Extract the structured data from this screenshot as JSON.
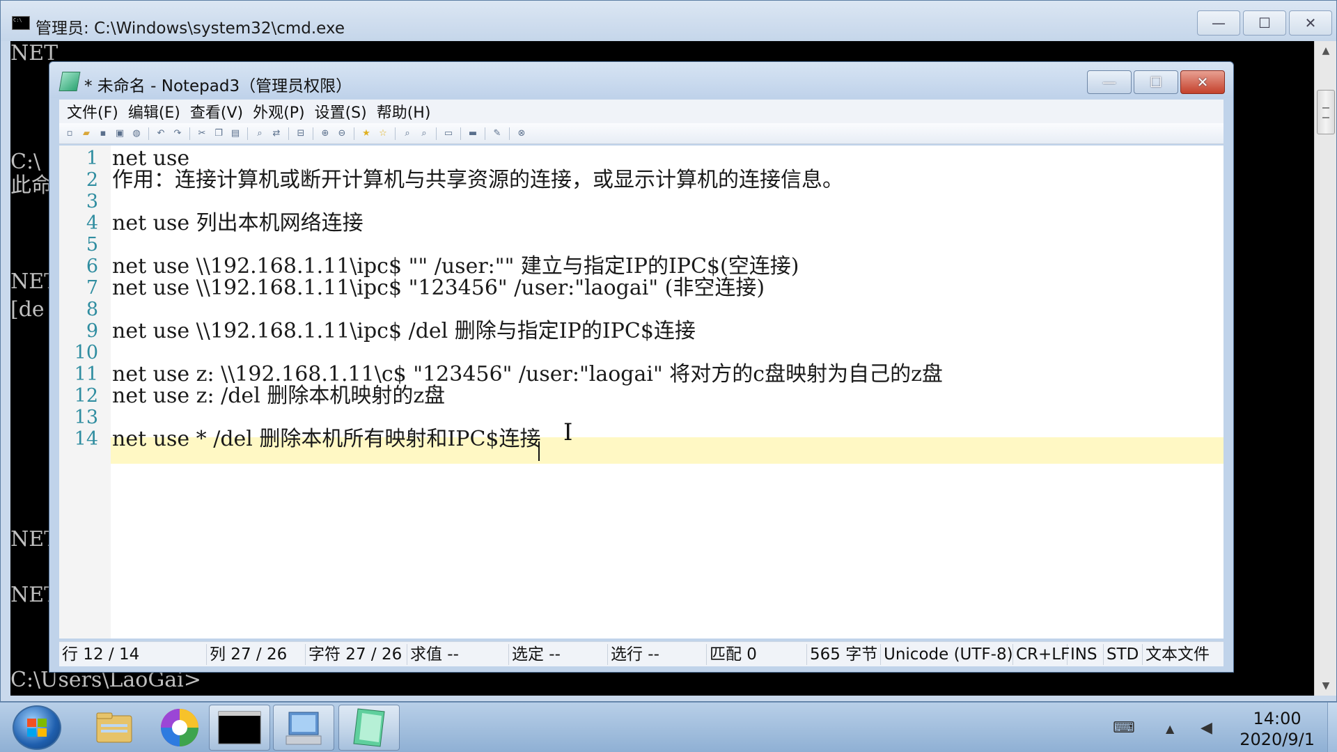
{
  "cmd": {
    "title": "管理员: C:\\Windows\\system32\\cmd.exe",
    "controls": {
      "minimize": "—",
      "maximize": "☐",
      "close": "✕"
    },
    "lines": [
      "NET",
      "C:\\",
      "此命",
      "NET",
      "[de",
      "NET",
      "NET",
      "C:\\Users\\LaoGai>"
    ]
  },
  "notepad": {
    "title": "* 未命名 - Notepad3（管理员权限）",
    "controls": {
      "minimize": "—",
      "maximize": "☐",
      "close": "✕"
    },
    "menu": [
      "文件(F)",
      "编辑(E)",
      "查看(V)",
      "外观(P)",
      "设置(S)",
      "帮助(H)"
    ],
    "line_numbers": [
      "1",
      "2",
      "3",
      "4",
      "5",
      "6",
      "7",
      "8",
      "9",
      "10",
      "11",
      "12",
      "13",
      "14"
    ],
    "lines": [
      "net use",
      "作用：连接计算机或断开计算机与共享资源的连接，或显示计算机的连接信息。",
      "",
      "net use 列出本机网络连接",
      "",
      "net use \\\\192.168.1.11\\ipc$ \"\" /user:\"\" 建立与指定IP的IPC$(空连接)",
      "net use \\\\192.168.1.11\\ipc$ \"123456\" /user:\"laogai\" (非空连接)",
      "",
      "net use \\\\192.168.1.11\\ipc$ /del 删除与指定IP的IPC$连接",
      "",
      "net use z: \\\\192.168.1.11\\c$ \"123456\" /user:\"laogai\" 将对方的c盘映射为自己的z盘",
      "net use z: /del 删除本机映射的z盘",
      "",
      "net use * /del 删除本机所有映射和IPC$连接"
    ],
    "status": {
      "line": "行 12 / 14",
      "col": "列 27 / 26",
      "chars": "字符 27 / 26",
      "eval": "求值 --",
      "selection": "选定 --",
      "sel_lines": "选行 --",
      "matches": "匹配 0",
      "size": "565 字节",
      "encoding": "Unicode (UTF-8)",
      "eol": "CR+LF",
      "ins": "INS",
      "std": "STD",
      "type": "文本文件"
    }
  },
  "taskbar": {
    "time": "14:00",
    "date": "2020/9/1"
  }
}
